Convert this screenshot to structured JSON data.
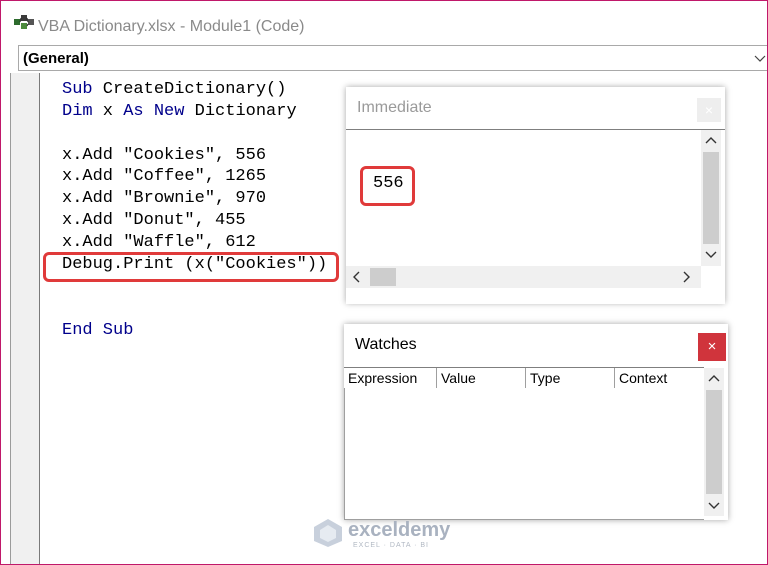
{
  "window": {
    "title": "VBA Dictionary.xlsx - Module1 (Code)"
  },
  "procedure_combo": {
    "value": "(General)"
  },
  "code": {
    "lines": [
      {
        "kw": "Sub",
        "rest": " CreateDictionary()"
      },
      {
        "kw": "Dim",
        "rest": " x ",
        "kw2": "As New",
        "rest2": " Dictionary"
      },
      {
        "text": "x.Add \"Cookies\", 556"
      },
      {
        "text": "x.Add \"Coffee\", 1265"
      },
      {
        "text": "x.Add \"Brownie\", 970"
      },
      {
        "text": "x.Add \"Donut\", 455"
      },
      {
        "text": "x.Add \"Waffle\", 612"
      },
      {
        "text": "Debug.Print (x(\"Cookies\"))"
      },
      {
        "kw": "End Sub",
        "rest": ""
      }
    ]
  },
  "immediate": {
    "title": "Immediate",
    "close_label": "×",
    "output": "556"
  },
  "watches": {
    "title": "Watches",
    "close_label": "×",
    "columns": [
      "Expression",
      "Value",
      "Type",
      "Context"
    ]
  },
  "watermark": {
    "brand": "exceldemy",
    "tagline": "EXCEL · DATA · BI"
  },
  "colors": {
    "highlight": "#e03a3a",
    "keyword": "#00008b",
    "close_button": "#d0343c"
  }
}
